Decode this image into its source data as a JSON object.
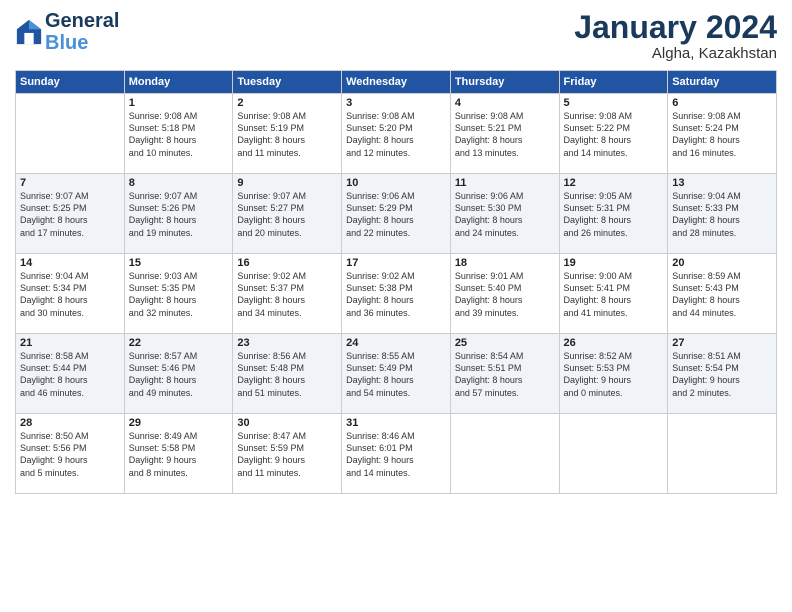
{
  "header": {
    "logo_line1": "General",
    "logo_line2": "Blue",
    "title": "January 2024",
    "subtitle": "Algha, Kazakhstan"
  },
  "days_of_week": [
    "Sunday",
    "Monday",
    "Tuesday",
    "Wednesday",
    "Thursday",
    "Friday",
    "Saturday"
  ],
  "weeks": [
    [
      {
        "day": "",
        "info": ""
      },
      {
        "day": "1",
        "info": "Sunrise: 9:08 AM\nSunset: 5:18 PM\nDaylight: 8 hours\nand 10 minutes."
      },
      {
        "day": "2",
        "info": "Sunrise: 9:08 AM\nSunset: 5:19 PM\nDaylight: 8 hours\nand 11 minutes."
      },
      {
        "day": "3",
        "info": "Sunrise: 9:08 AM\nSunset: 5:20 PM\nDaylight: 8 hours\nand 12 minutes."
      },
      {
        "day": "4",
        "info": "Sunrise: 9:08 AM\nSunset: 5:21 PM\nDaylight: 8 hours\nand 13 minutes."
      },
      {
        "day": "5",
        "info": "Sunrise: 9:08 AM\nSunset: 5:22 PM\nDaylight: 8 hours\nand 14 minutes."
      },
      {
        "day": "6",
        "info": "Sunrise: 9:08 AM\nSunset: 5:24 PM\nDaylight: 8 hours\nand 16 minutes."
      }
    ],
    [
      {
        "day": "7",
        "info": "Sunrise: 9:07 AM\nSunset: 5:25 PM\nDaylight: 8 hours\nand 17 minutes."
      },
      {
        "day": "8",
        "info": "Sunrise: 9:07 AM\nSunset: 5:26 PM\nDaylight: 8 hours\nand 19 minutes."
      },
      {
        "day": "9",
        "info": "Sunrise: 9:07 AM\nSunset: 5:27 PM\nDaylight: 8 hours\nand 20 minutes."
      },
      {
        "day": "10",
        "info": "Sunrise: 9:06 AM\nSunset: 5:29 PM\nDaylight: 8 hours\nand 22 minutes."
      },
      {
        "day": "11",
        "info": "Sunrise: 9:06 AM\nSunset: 5:30 PM\nDaylight: 8 hours\nand 24 minutes."
      },
      {
        "day": "12",
        "info": "Sunrise: 9:05 AM\nSunset: 5:31 PM\nDaylight: 8 hours\nand 26 minutes."
      },
      {
        "day": "13",
        "info": "Sunrise: 9:04 AM\nSunset: 5:33 PM\nDaylight: 8 hours\nand 28 minutes."
      }
    ],
    [
      {
        "day": "14",
        "info": "Sunrise: 9:04 AM\nSunset: 5:34 PM\nDaylight: 8 hours\nand 30 minutes."
      },
      {
        "day": "15",
        "info": "Sunrise: 9:03 AM\nSunset: 5:35 PM\nDaylight: 8 hours\nand 32 minutes."
      },
      {
        "day": "16",
        "info": "Sunrise: 9:02 AM\nSunset: 5:37 PM\nDaylight: 8 hours\nand 34 minutes."
      },
      {
        "day": "17",
        "info": "Sunrise: 9:02 AM\nSunset: 5:38 PM\nDaylight: 8 hours\nand 36 minutes."
      },
      {
        "day": "18",
        "info": "Sunrise: 9:01 AM\nSunset: 5:40 PM\nDaylight: 8 hours\nand 39 minutes."
      },
      {
        "day": "19",
        "info": "Sunrise: 9:00 AM\nSunset: 5:41 PM\nDaylight: 8 hours\nand 41 minutes."
      },
      {
        "day": "20",
        "info": "Sunrise: 8:59 AM\nSunset: 5:43 PM\nDaylight: 8 hours\nand 44 minutes."
      }
    ],
    [
      {
        "day": "21",
        "info": "Sunrise: 8:58 AM\nSunset: 5:44 PM\nDaylight: 8 hours\nand 46 minutes."
      },
      {
        "day": "22",
        "info": "Sunrise: 8:57 AM\nSunset: 5:46 PM\nDaylight: 8 hours\nand 49 minutes."
      },
      {
        "day": "23",
        "info": "Sunrise: 8:56 AM\nSunset: 5:48 PM\nDaylight: 8 hours\nand 51 minutes."
      },
      {
        "day": "24",
        "info": "Sunrise: 8:55 AM\nSunset: 5:49 PM\nDaylight: 8 hours\nand 54 minutes."
      },
      {
        "day": "25",
        "info": "Sunrise: 8:54 AM\nSunset: 5:51 PM\nDaylight: 8 hours\nand 57 minutes."
      },
      {
        "day": "26",
        "info": "Sunrise: 8:52 AM\nSunset: 5:53 PM\nDaylight: 9 hours\nand 0 minutes."
      },
      {
        "day": "27",
        "info": "Sunrise: 8:51 AM\nSunset: 5:54 PM\nDaylight: 9 hours\nand 2 minutes."
      }
    ],
    [
      {
        "day": "28",
        "info": "Sunrise: 8:50 AM\nSunset: 5:56 PM\nDaylight: 9 hours\nand 5 minutes."
      },
      {
        "day": "29",
        "info": "Sunrise: 8:49 AM\nSunset: 5:58 PM\nDaylight: 9 hours\nand 8 minutes."
      },
      {
        "day": "30",
        "info": "Sunrise: 8:47 AM\nSunset: 5:59 PM\nDaylight: 9 hours\nand 11 minutes."
      },
      {
        "day": "31",
        "info": "Sunrise: 8:46 AM\nSunset: 6:01 PM\nDaylight: 9 hours\nand 14 minutes."
      },
      {
        "day": "",
        "info": ""
      },
      {
        "day": "",
        "info": ""
      },
      {
        "day": "",
        "info": ""
      }
    ]
  ]
}
